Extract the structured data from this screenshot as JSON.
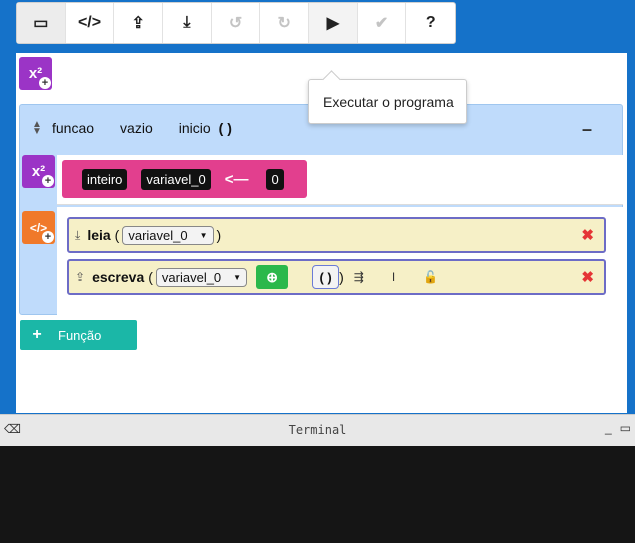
{
  "toolbar": {
    "buttons": [
      {
        "name": "window-icon",
        "glyph": "▭"
      },
      {
        "name": "code-icon",
        "glyph": "</>"
      },
      {
        "name": "upload-icon",
        "glyph": "⇪"
      },
      {
        "name": "download-icon",
        "glyph": "⤓"
      },
      {
        "name": "undo-icon",
        "glyph": "↺"
      },
      {
        "name": "redo-icon",
        "glyph": "↻"
      },
      {
        "name": "play-icon",
        "glyph": "▶"
      },
      {
        "name": "check-icon",
        "glyph": "✔"
      },
      {
        "name": "help-icon",
        "glyph": "?"
      }
    ]
  },
  "tooltip": {
    "text": "Executar o programa"
  },
  "global_vars_button": {
    "label": "x²"
  },
  "function": {
    "keyword": "funcao",
    "return_type": "vazio",
    "name": "inicio",
    "parens": "( )",
    "minimize": "–"
  },
  "variable_decl": {
    "type": "inteiro",
    "name": "variavel_0",
    "assign": "<—",
    "value": "0",
    "add_var_label": "x²",
    "add_cmd_label": "</>"
  },
  "commands": {
    "read": {
      "keyword": "leia",
      "open": "(",
      "var": "variavel_0",
      "close": ")"
    },
    "write": {
      "keyword": "escreva",
      "open": "(",
      "var": "variavel_0",
      "expr": "( )",
      "close": ")"
    }
  },
  "add_function": {
    "plus": "+",
    "label": "Função"
  },
  "terminal": {
    "title": "Terminal"
  },
  "colors": {
    "accent": "#1572c9",
    "declaration": "#e23f8e",
    "command": "#f6f0c7",
    "add_function": "#1bb7a7"
  }
}
